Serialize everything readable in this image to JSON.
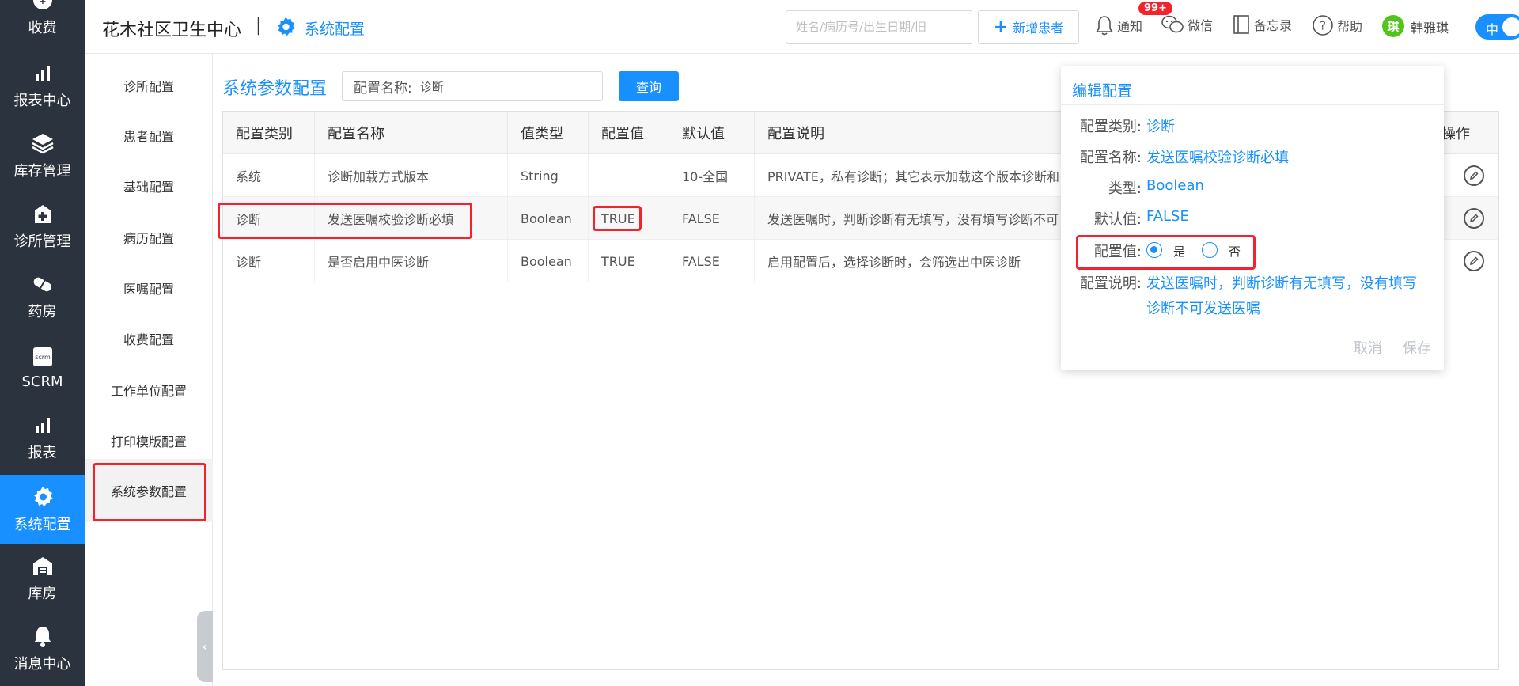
{
  "sidebar": {
    "items": [
      {
        "label": "收费",
        "icon": "yuan-icon"
      },
      {
        "label": "报表中心",
        "icon": "bar-chart-icon"
      },
      {
        "label": "库存管理",
        "icon": "layers-icon"
      },
      {
        "label": "诊所管理",
        "icon": "medical-plus-icon"
      },
      {
        "label": "药房",
        "icon": "pill-icon"
      },
      {
        "label": "SCRM",
        "icon": "scrm-icon"
      },
      {
        "label": "报表",
        "icon": "bar-chart-icon"
      },
      {
        "label": "系统配置",
        "icon": "gear-icon"
      },
      {
        "label": "库房",
        "icon": "warehouse-icon"
      },
      {
        "label": "消息中心",
        "icon": "bell-icon"
      }
    ],
    "active_index": 7,
    "active_color": "#1890ff"
  },
  "header": {
    "clinic_name": "花木社区卫生中心",
    "separator": "|",
    "breadcrumb": "系统配置",
    "search_placeholder": "姓名/病历号/出生日期/旧",
    "add_patient_label": "新增患者",
    "notify_label": "通知",
    "notify_badge": "99+",
    "wechat_label": "微信",
    "memo_label": "备忘录",
    "help_label": "帮助",
    "avatar_char": "琪",
    "username": "韩雅琪",
    "toggle_label": "中"
  },
  "submenu": {
    "items": [
      "诊所配置",
      "患者配置",
      "基础配置",
      "病历配置",
      "医嘱配置",
      "收费配置",
      "工作单位配置",
      "打印模版配置",
      "系统参数配置"
    ],
    "active_index": 8
  },
  "main": {
    "title": "系统参数配置",
    "filter_label": "配置名称:",
    "filter_value": "诊断",
    "query_label": "查询"
  },
  "table": {
    "columns": [
      "配置类别",
      "配置名称",
      "值类型",
      "配置值",
      "默认值",
      "配置说明",
      "操作"
    ],
    "rows": [
      {
        "category": "系统",
        "name": "诊断加载方式版本",
        "type": "String",
        "value": "",
        "default": "10-全国",
        "desc": "PRIVATE，私有诊断；其它表示加载这个版本诊断和"
      },
      {
        "category": "诊断",
        "name": "发送医嘱校验诊断必填",
        "type": "Boolean",
        "value": "TRUE",
        "default": "FALSE",
        "desc": "发送医嘱时，判断诊断有无填写，没有填写诊断不可"
      },
      {
        "category": "诊断",
        "name": "是否启用中医诊断",
        "type": "Boolean",
        "value": "TRUE",
        "default": "FALSE",
        "desc": "启用配置后，选择诊断时，会筛选出中医诊断"
      }
    ]
  },
  "popover": {
    "title": "编辑配置",
    "category_key": "配置类别:",
    "category_val": "诊断",
    "name_key": "配置名称:",
    "name_val": "发送医嘱校验诊断必填",
    "type_key": "类型:",
    "type_val": "Boolean",
    "default_key": "默认值:",
    "default_val": "FALSE",
    "value_key": "配置值:",
    "radio_yes": "是",
    "radio_no": "否",
    "selected": "是",
    "desc_key": "配置说明:",
    "desc_line1": "发送医嘱时，判断诊断有无填写，没有填写",
    "desc_line2": "诊断不可发送医嘱",
    "cancel_label": "取消",
    "save_label": "保存"
  },
  "colors": {
    "accent": "#1890ff",
    "sidebar_bg": "#2b333e",
    "highlight": "#f5222d"
  }
}
